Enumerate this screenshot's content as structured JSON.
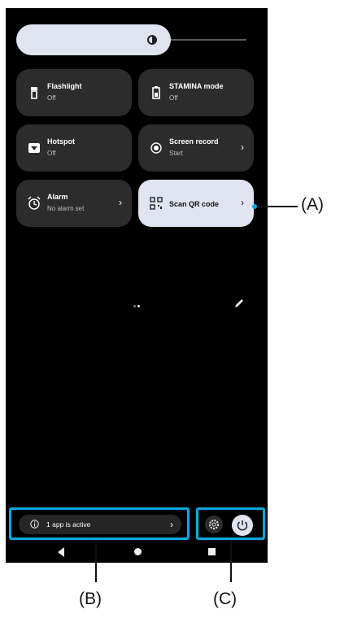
{
  "tiles": {
    "flashlight": {
      "title": "Flashlight",
      "status": "Off",
      "icon": "flashlight-icon"
    },
    "stamina": {
      "title": "STAMINA mode",
      "status": "Off",
      "icon": "battery-icon"
    },
    "hotspot": {
      "title": "Hotspot",
      "status": "Off",
      "icon": "hotspot-icon"
    },
    "screen_record": {
      "title": "Screen record",
      "status": "Start",
      "icon": "record-icon"
    },
    "alarm": {
      "title": "Alarm",
      "status": "No alarm set",
      "icon": "alarm-icon"
    },
    "scan_qr": {
      "title": "Scan QR code",
      "icon": "qr-code-icon"
    }
  },
  "active_apps": {
    "label": "1 app is active"
  },
  "chevron": "›",
  "callouts": {
    "a": "(A)",
    "b": "(B)",
    "c": "(C)"
  },
  "colors": {
    "accent_pill": "#dfe4f0",
    "tile_bg": "#2c2c2c",
    "highlight_border": "#0aa9df",
    "panel_bg": "#000000"
  }
}
